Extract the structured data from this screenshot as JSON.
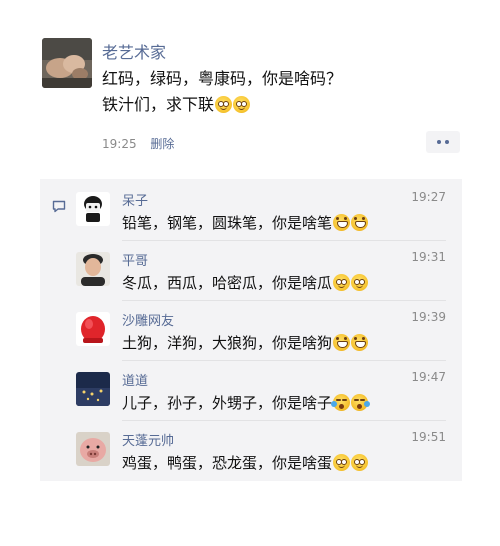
{
  "post": {
    "author": "老艺术家",
    "line1": "红码，绿码，粤康码，你是啥码？",
    "line2": "铁汁们，求下联",
    "time": "19:25",
    "delete_label": "删除"
  },
  "comments": [
    {
      "name": "呆子",
      "time": "19:27",
      "text": "铅笔，钢笔，圆珠笔，你是啥笔"
    },
    {
      "name": "平哥",
      "time": "19:31",
      "text": "冬瓜，西瓜，哈密瓜，你是啥瓜"
    },
    {
      "name": "沙雕网友",
      "time": "19:39",
      "text": "土狗，洋狗，大狼狗，你是啥狗"
    },
    {
      "name": "道道",
      "time": "19:47",
      "text": "儿子，孙子，外甥子，你是啥子"
    },
    {
      "name": "天蓬元帅",
      "time": "19:51",
      "text": "鸡蛋，鸭蛋，恐龙蛋，你是啥蛋"
    }
  ],
  "icons": {
    "more": "more-dots-icon",
    "comment": "comment-bubble-icon"
  },
  "colors": {
    "link_blue": "#576b95",
    "comment_bg": "#f3f3f5",
    "meta_gray": "#8a8a8a"
  }
}
